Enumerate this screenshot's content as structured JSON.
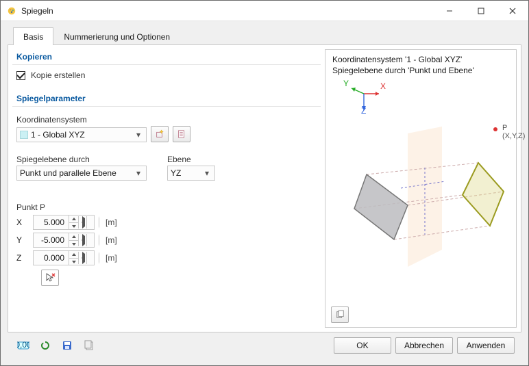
{
  "window": {
    "title": "Spiegeln"
  },
  "tabs": {
    "basis": "Basis",
    "options": "Nummerierung und Optionen",
    "active": "basis"
  },
  "copy": {
    "title": "Kopieren",
    "checkbox_label": "Kopie erstellen",
    "checked": true
  },
  "params": {
    "title": "Spiegelparameter",
    "coord_label": "Koordinatensystem",
    "coord_value": "1 - Global XYZ",
    "mirror_by_label": "Spiegelebene durch",
    "mirror_by_value": "Punkt und parallele Ebene",
    "plane_label": "Ebene",
    "plane_value": "YZ"
  },
  "point": {
    "title": "Punkt P",
    "x_label": "X",
    "x_value": "5.000",
    "y_label": "Y",
    "y_value": "-5.000",
    "z_label": "Z",
    "z_value": "0.000",
    "unit": "[m]"
  },
  "preview": {
    "line1": "Koordinatensystem '1 - Global XYZ'",
    "line2": "Spiegelebene durch 'Punkt und Ebene'",
    "axis_x": "X",
    "axis_y": "Y",
    "axis_z": "Z",
    "point_label": "P (X,Y,Z)"
  },
  "buttons": {
    "ok": "OK",
    "cancel": "Abbrechen",
    "apply": "Anwenden"
  },
  "icons": {
    "title_icon": "palette-icon",
    "new_cs": "new-coordinate-system-icon",
    "edit_cs": "edit-coordinate-system-icon",
    "pick": "pick-point-icon",
    "preview_tool": "copy-to-clipboard-icon",
    "footer_units": "units-icon",
    "footer_reload": "refresh-icon",
    "footer_save": "save-icon",
    "footer_copy": "clipboard-icon"
  },
  "chart_data": {
    "type": "diagram",
    "description": "3D preview of object mirrored through plane parallel to YZ at point P",
    "axes": [
      "X",
      "Y",
      "Z"
    ],
    "plane": "YZ",
    "point": {
      "x": 5.0,
      "y": -5.0,
      "z": 0.0,
      "label": "P (X,Y,Z)"
    }
  }
}
